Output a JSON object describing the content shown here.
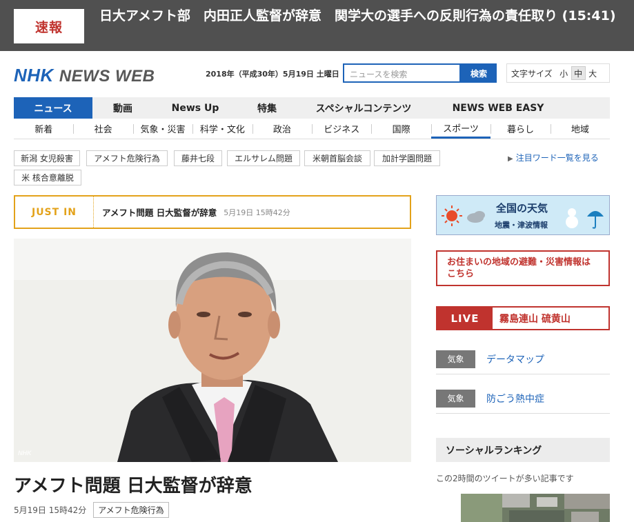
{
  "breaking": {
    "badge": "速報",
    "text": "日大アメフト部　内田正人監督が辞意　関学大の選手への反則行為の責任取り (15:41)"
  },
  "header": {
    "logo_nhk": "NHK",
    "logo_newsweb": "NEWS WEB",
    "date": "2018年（平成30年）5月19日 土曜日",
    "search_placeholder": "ニュースを検索",
    "search_button": "検索",
    "font_size_label": "文字サイズ",
    "font_sizes": [
      "小",
      "中",
      "大"
    ],
    "font_size_selected": "中"
  },
  "main_nav": [
    "ニュース",
    "動画",
    "News Up",
    "特集",
    "スペシャルコンテンツ",
    "NEWS WEB EASY"
  ],
  "main_nav_active": "ニュース",
  "sub_nav": [
    "新着",
    "社会",
    "気象・災害",
    "科学・文化",
    "政治",
    "ビジネス",
    "国際",
    "スポーツ",
    "暮らし",
    "地域"
  ],
  "sub_nav_active": "スポーツ",
  "tags": [
    "新潟 女児殺害",
    "アメフト危険行為",
    "藤井七段",
    "エルサレム問題",
    "米朝首脳会談",
    "加計学園問題",
    "米 核合意離脱"
  ],
  "see_all": "注目ワード一覧を見る",
  "just_in": {
    "label": "JUST IN",
    "headline": "アメフト問題 日大監督が辞意",
    "time": "5月19日 15時42分"
  },
  "photo": {
    "watermark": "NHK"
  },
  "article": {
    "title": "アメフト問題 日大監督が辞意",
    "time": "5月19日 15時42分",
    "tag": "アメフト危険行為"
  },
  "sidebar": {
    "weather_title": "全国の天気",
    "weather_sub": "地震・津波情報",
    "disaster": "お住まいの地域の避難・災害情報はこちら",
    "live_label": "LIVE",
    "live_text": "霧島連山 硫黄山",
    "links": [
      {
        "label": "気象",
        "text": "データマップ"
      },
      {
        "label": "気象",
        "text": "防ごう熱中症"
      }
    ],
    "social_title": "ソーシャルランキング",
    "social_sub": "この2時間のツイートが多い記事です"
  },
  "colors": {
    "brand_blue": "#1d63b8",
    "breaking_bg": "#505050",
    "alert_red": "#c0332e",
    "justin_orange": "#e3a21a"
  }
}
